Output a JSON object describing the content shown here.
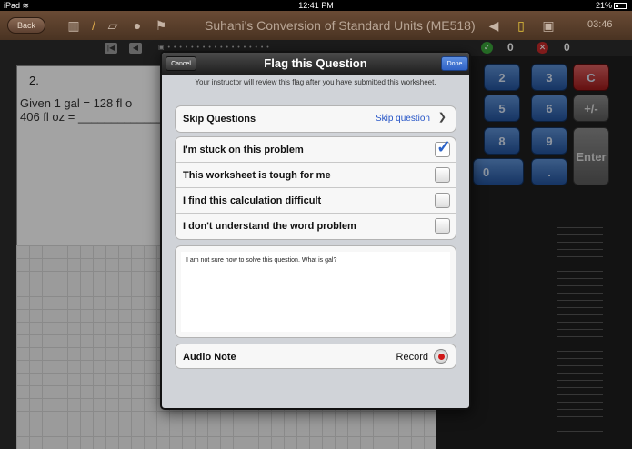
{
  "status_bar": {
    "device": "iPad",
    "time": "12:41 PM",
    "battery": "21%"
  },
  "toolbar": {
    "back_label": "Back",
    "title": "Suhani's Conversion of Standard Units (ME518)",
    "timer": "03:46"
  },
  "nav": {
    "correct_count": "0",
    "wrong_count": "0"
  },
  "worksheet": {
    "question_number": "2.",
    "line1": "Given 1 gal = 128 fl o",
    "line2": "406 fl oz = ______________"
  },
  "keypad": {
    "keys": [
      "2",
      "3",
      "C",
      "5",
      "6",
      "+/-",
      "8",
      "9",
      "Enter",
      "0",
      "."
    ]
  },
  "modal": {
    "title": "Flag this Question",
    "cancel_label": "Cancel",
    "done_label": "Done",
    "subtitle": "Your instructor will review this flag after you have submitted this worksheet.",
    "skip_label": "Skip Questions",
    "skip_value": "Skip question",
    "options": [
      {
        "label": "I'm stuck on this problem",
        "checked": true
      },
      {
        "label": "This worksheet is tough for me",
        "checked": false
      },
      {
        "label": "I find this calculation difficult",
        "checked": false
      },
      {
        "label": "I don't understand the word problem",
        "checked": false
      }
    ],
    "note_text": "I am not sure how to solve this question. What is gal?",
    "audio_label": "Audio Note",
    "record_label": "Record"
  },
  "colors": {
    "toolbar": "#5a3e2a",
    "key_blue": "#2f62b0",
    "key_red": "#b02424",
    "check_blue": "#2b63c9"
  },
  "icons": [
    "wifi-icon",
    "battery-icon",
    "trash-icon",
    "pencil-icon",
    "eraser-icon",
    "comment-icon",
    "flag-icon",
    "speaker-icon",
    "clipboard-icon",
    "screen-icon",
    "check-circle-icon",
    "x-circle-icon",
    "chevron-down-icon",
    "record-icon"
  ]
}
